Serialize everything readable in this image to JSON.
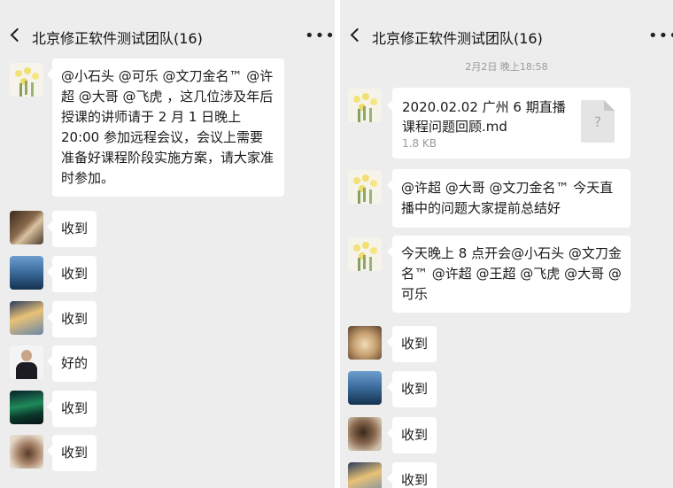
{
  "left": {
    "header": {
      "title": "北京修正软件测试团队(16)",
      "more": "•••"
    },
    "messages": [
      {
        "avatar": "flower",
        "text": "@小石头 @可乐 @文刀金名™ @许超 @大哥 @飞虎 ，这几位涉及年后授课的讲师请于 2 月 1 日晚上 20:00 参加远程会议，会议上需要准备好课程阶段实施方案，请大家准时参加。"
      },
      {
        "avatar": "cat",
        "text": "收到"
      },
      {
        "avatar": "sea",
        "text": "收到"
      },
      {
        "avatar": "tower",
        "text": "收到"
      },
      {
        "avatar": "man",
        "text": "好的"
      },
      {
        "avatar": "aurora",
        "text": "收到"
      },
      {
        "avatar": "cat",
        "text": "收到"
      }
    ]
  },
  "right": {
    "header": {
      "title": "北京修正软件测试团队(16)",
      "more": "•••"
    },
    "timestamp": "2月2日 晚上18:58",
    "file": {
      "name": "2020.02.02 广州 6 期直播课程问题回顾.md",
      "size": "1.8 KB",
      "icon_glyph": "?"
    },
    "messages": [
      {
        "avatar": "flower",
        "text": "@许超 @大哥 @文刀金名™ 今天直播中的问题大家提前总结好"
      },
      {
        "avatar": "flower",
        "text": "今天晚上 8 点开会@小石头 @文刀金名™ @许超 @王超 @飞虎 @大哥 @可乐"
      },
      {
        "avatar": "dog",
        "text": "收到"
      },
      {
        "avatar": "sea",
        "text": "收到"
      },
      {
        "avatar": "cat",
        "text": "收到"
      },
      {
        "avatar": "tower",
        "text": "收到"
      }
    ]
  }
}
